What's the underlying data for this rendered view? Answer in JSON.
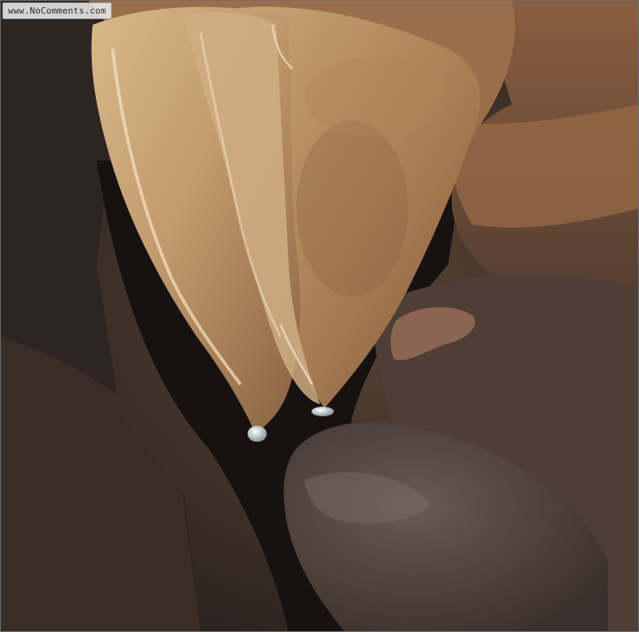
{
  "photo": {
    "subject": "cave-stalactite",
    "palette": {
      "rock_dark": "#2a2420",
      "rock_brown": "#6b4a36",
      "flowstone_light": "#c9a77c",
      "flowstone_mid": "#a87c55",
      "water_drop": "#d9e2e6"
    }
  },
  "watermark": {
    "text": "www.NoComments.com"
  }
}
